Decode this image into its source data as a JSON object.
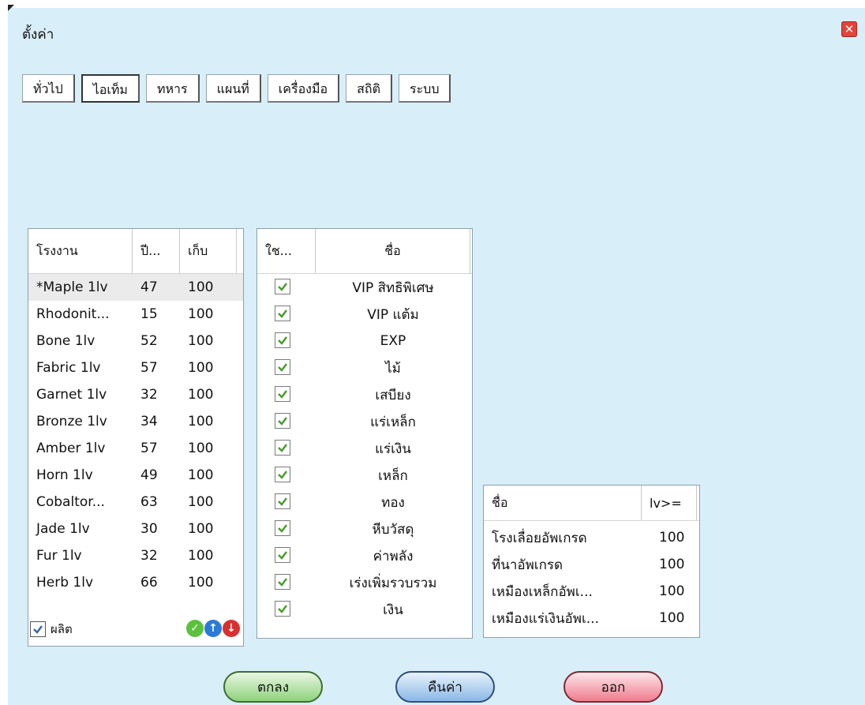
{
  "window": {
    "title": "ตั้งค่า"
  },
  "tabs": [
    "ทั่วไป",
    "ไอเท็ม",
    "ทหาร",
    "แผนที่",
    "เครื่องมือ",
    "สถิติ",
    "ระบบ"
  ],
  "factories": {
    "headers": [
      "โรงงาน",
      "ปี...",
      "เก็บ"
    ],
    "rows": [
      [
        "*Maple 1lv",
        "47",
        "100"
      ],
      [
        "Rhodonit...",
        "15",
        "100"
      ],
      [
        "Bone 1lv",
        "52",
        "100"
      ],
      [
        "Fabric 1lv",
        "57",
        "100"
      ],
      [
        "Garnet 1lv",
        "32",
        "100"
      ],
      [
        "Bronze 1lv",
        "34",
        "100"
      ],
      [
        "Amber 1lv",
        "57",
        "100"
      ],
      [
        "Horn 1lv",
        "49",
        "100"
      ],
      [
        "Cobaltor...",
        "63",
        "100"
      ],
      [
        "Jade 1lv",
        "30",
        "100"
      ],
      [
        "Fur 1lv",
        "32",
        "100"
      ],
      [
        "Herb 1lv",
        "66",
        "100"
      ]
    ],
    "produce_label": "ผลิต"
  },
  "items": {
    "headers": [
      "ใช...",
      "ชื่อ"
    ],
    "rows": [
      "VIP สิทธิพิเศษ",
      "VIP แต้ม",
      "EXP",
      "ไม้",
      "เสบียง",
      "แร่เหล็ก",
      "แร่เงิน",
      "เหล็ก",
      "ทอง",
      "หีบวัสดุ",
      "ค่าพลัง",
      "เร่งเพิ่มรวบรวม",
      "เงิน"
    ]
  },
  "upgrades": {
    "headers": [
      "ชื่อ",
      "lv>="
    ],
    "rows": [
      [
        "โรงเลื่อยอัพเกรด",
        "100"
      ],
      [
        "ที่นาอัพเกรด",
        "100"
      ],
      [
        "เหมืองเหล็กอัพเ...",
        "100"
      ],
      [
        "เหมืองแร่เงินอัพเ...",
        "100"
      ]
    ]
  },
  "buttons": {
    "ok": "ตกลง",
    "reset": "คืนค่า",
    "exit": "ออก"
  }
}
